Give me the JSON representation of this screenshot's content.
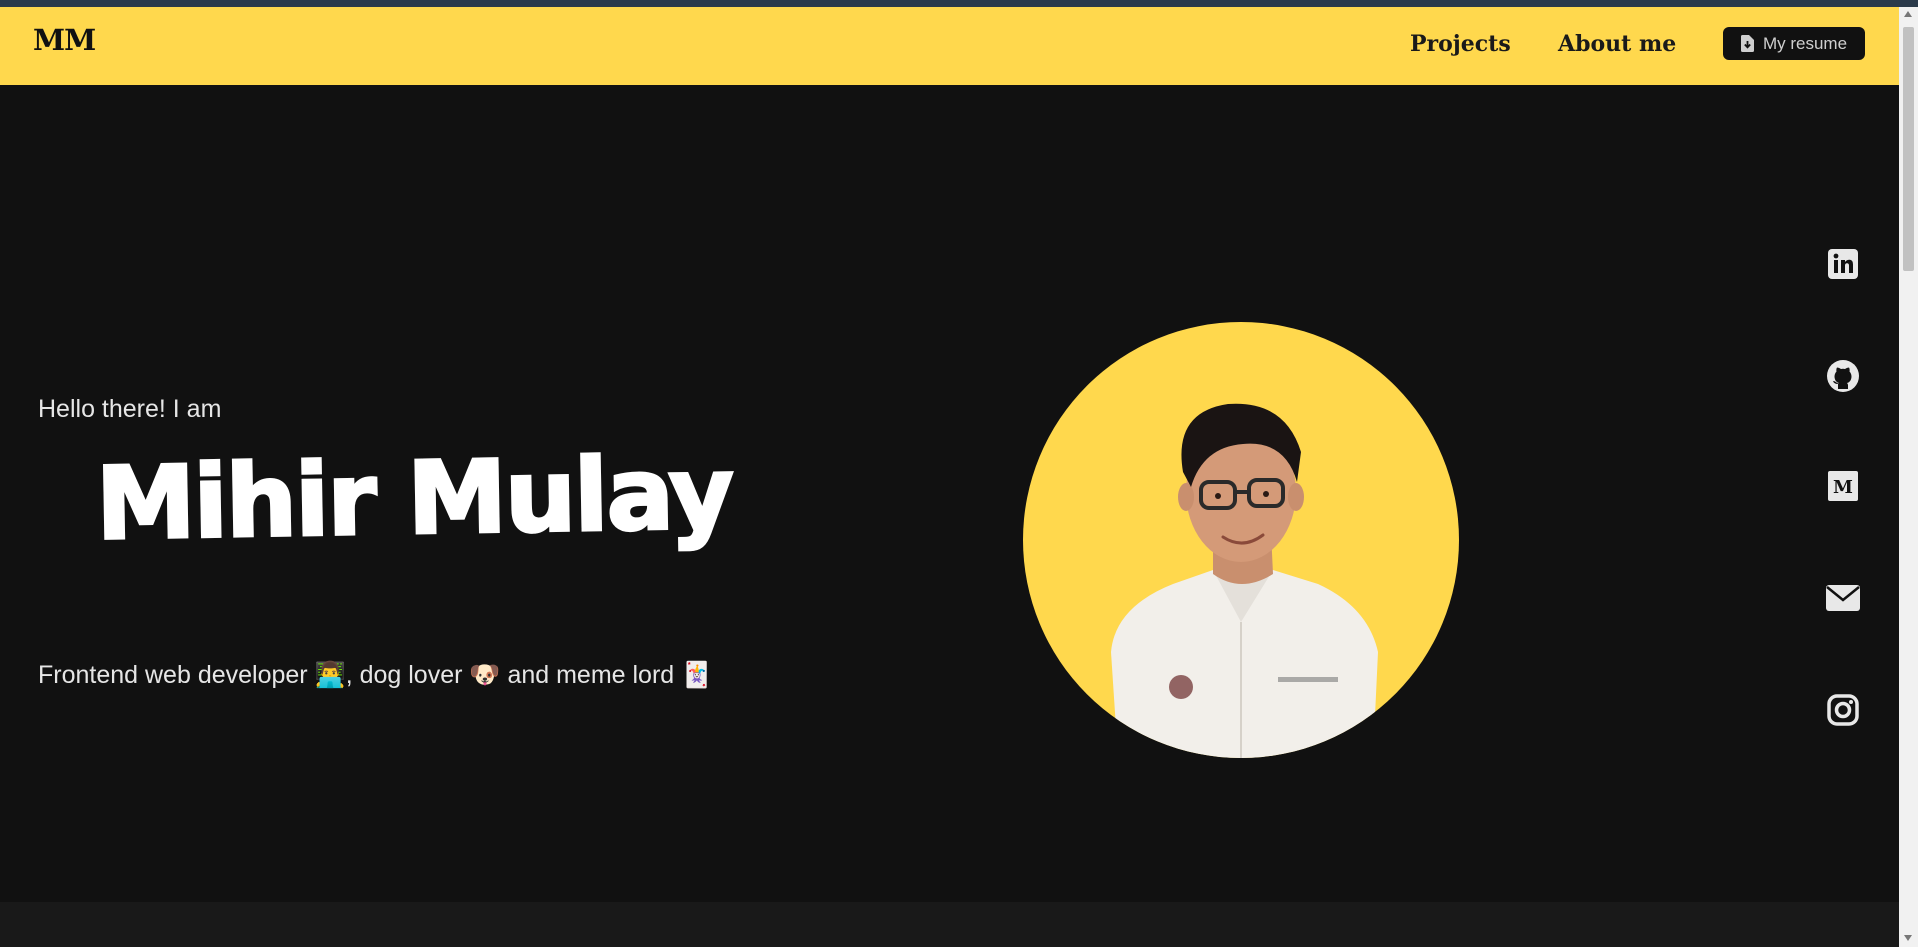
{
  "nav": {
    "logo": "MM",
    "links": [
      "Projects",
      "About me"
    ],
    "resume_label": "My resume"
  },
  "hero": {
    "greeting": "Hello there! I am",
    "name": "Mihir Mulay",
    "tagline": "Frontend web developer 👨‍💻, dog lover 🐶 and meme lord 🃏"
  },
  "social": {
    "icons": [
      "linkedin-icon",
      "github-icon",
      "medium-icon",
      "mail-icon",
      "instagram-icon"
    ]
  },
  "colors": {
    "accent": "#ffd84d",
    "background": "#111111"
  }
}
